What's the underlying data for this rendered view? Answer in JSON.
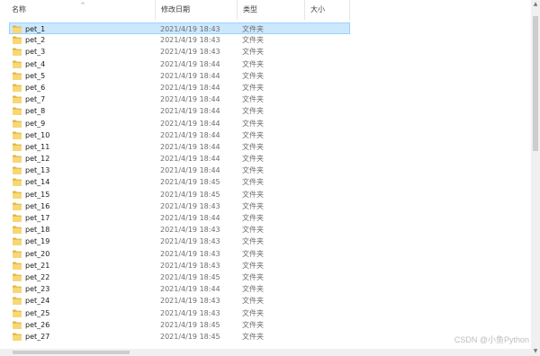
{
  "columns": {
    "name": "名称",
    "date": "修改日期",
    "type": "类型",
    "size": "大小"
  },
  "rows": [
    {
      "name": "pet_1",
      "date": "2021/4/19 18:43",
      "type": "文件夹"
    },
    {
      "name": "pet_2",
      "date": "2021/4/19 18:43",
      "type": "文件夹"
    },
    {
      "name": "pet_3",
      "date": "2021/4/19 18:43",
      "type": "文件夹"
    },
    {
      "name": "pet_4",
      "date": "2021/4/19 18:44",
      "type": "文件夹"
    },
    {
      "name": "pet_5",
      "date": "2021/4/19 18:44",
      "type": "文件夹"
    },
    {
      "name": "pet_6",
      "date": "2021/4/19 18:44",
      "type": "文件夹"
    },
    {
      "name": "pet_7",
      "date": "2021/4/19 18:44",
      "type": "文件夹"
    },
    {
      "name": "pet_8",
      "date": "2021/4/19 18:44",
      "type": "文件夹"
    },
    {
      "name": "pet_9",
      "date": "2021/4/19 18:44",
      "type": "文件夹"
    },
    {
      "name": "pet_10",
      "date": "2021/4/19 18:44",
      "type": "文件夹"
    },
    {
      "name": "pet_11",
      "date": "2021/4/19 18:44",
      "type": "文件夹"
    },
    {
      "name": "pet_12",
      "date": "2021/4/19 18:44",
      "type": "文件夹"
    },
    {
      "name": "pet_13",
      "date": "2021/4/19 18:44",
      "type": "文件夹"
    },
    {
      "name": "pet_14",
      "date": "2021/4/19 18:45",
      "type": "文件夹"
    },
    {
      "name": "pet_15",
      "date": "2021/4/19 18:45",
      "type": "文件夹"
    },
    {
      "name": "pet_16",
      "date": "2021/4/19 18:43",
      "type": "文件夹"
    },
    {
      "name": "pet_17",
      "date": "2021/4/19 18:44",
      "type": "文件夹"
    },
    {
      "name": "pet_18",
      "date": "2021/4/19 18:43",
      "type": "文件夹"
    },
    {
      "name": "pet_19",
      "date": "2021/4/19 18:43",
      "type": "文件夹"
    },
    {
      "name": "pet_20",
      "date": "2021/4/19 18:43",
      "type": "文件夹"
    },
    {
      "name": "pet_21",
      "date": "2021/4/19 18:43",
      "type": "文件夹"
    },
    {
      "name": "pet_22",
      "date": "2021/4/19 18:45",
      "type": "文件夹"
    },
    {
      "name": "pet_23",
      "date": "2021/4/19 18:44",
      "type": "文件夹"
    },
    {
      "name": "pet_24",
      "date": "2021/4/19 18:43",
      "type": "文件夹"
    },
    {
      "name": "pet_25",
      "date": "2021/4/19 18:43",
      "type": "文件夹"
    },
    {
      "name": "pet_26",
      "date": "2021/4/19 18:45",
      "type": "文件夹"
    },
    {
      "name": "pet_27",
      "date": "2021/4/19 18:45",
      "type": "文件夹"
    }
  ],
  "selected_index": 0,
  "watermark": "CSDN @小鱼Python",
  "colors": {
    "selection_bg": "#cce8ff",
    "selection_border": "#99d1ff",
    "folder_yellow": "#f8d775",
    "folder_dark": "#e0b545"
  }
}
